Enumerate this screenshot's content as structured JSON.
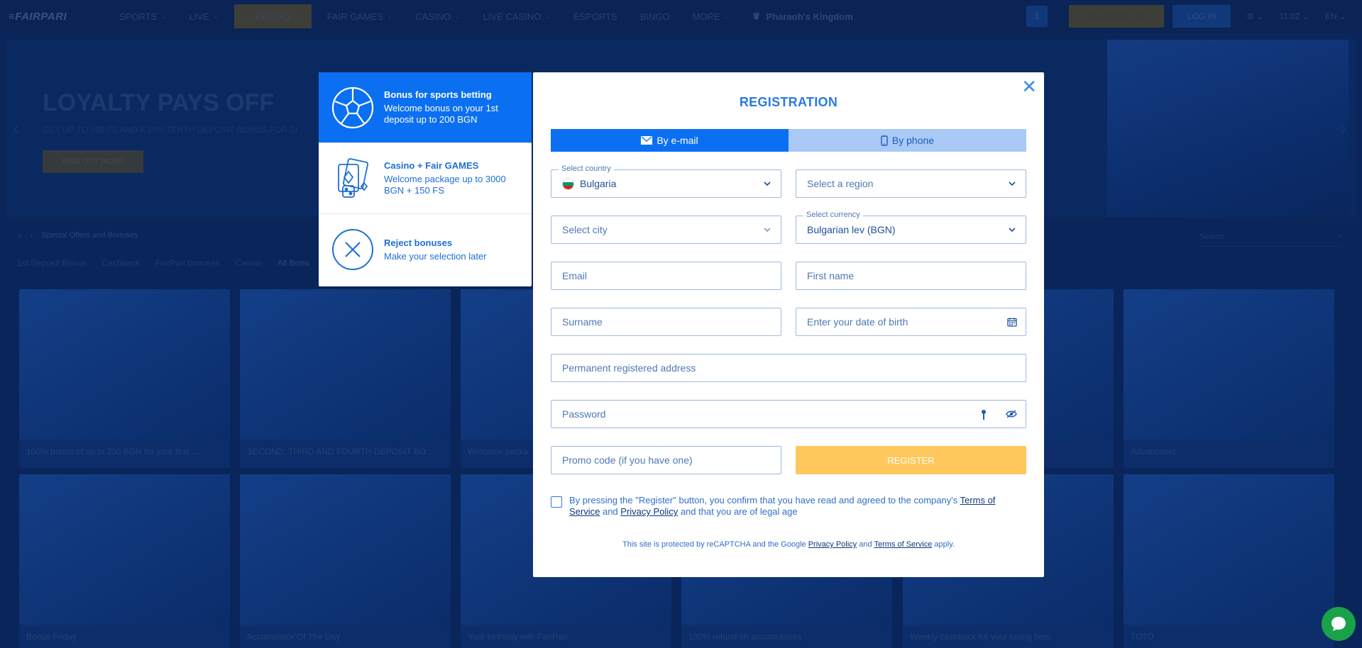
{
  "header": {
    "logo": "≡FAIRPARI",
    "nav": [
      {
        "label": "SPORTS",
        "chevron": true
      },
      {
        "label": "LIVE",
        "chevron": true
      },
      {
        "label": "PROMO",
        "chevron": true,
        "active": true
      },
      {
        "label": "FAIR GAMES",
        "chevron": true
      },
      {
        "label": "CASINO",
        "chevron": true
      },
      {
        "label": "LIVE CASINO",
        "chevron": true
      },
      {
        "label": "ESPORTS",
        "chevron": false
      },
      {
        "label": "BINGO",
        "chevron": false
      },
      {
        "label": "MORE",
        "chevron": true
      }
    ],
    "special": "Pharaoh's Kingdom",
    "notif_count": "1",
    "register_label": "REGISTRATION",
    "login_label": "LOG IN",
    "time": "11:02",
    "lang": "EN"
  },
  "hero": {
    "title": "LOYALTY PAYS OFF",
    "subtitle": "GET UP TO 100 FS AND A 50% TENTH DEPOSIT BONUS FOR SI",
    "button": "FIND OUT MORE"
  },
  "breadcrumbs": {
    "current": "Special Offers and Bonuses"
  },
  "tabs": [
    "1st Deposit Bonus",
    "Cashback",
    "FairPari bonuses",
    "Casino",
    "All Bonu"
  ],
  "search_placeholder": "Search",
  "cards_row1": [
    "100% bonus of up to 200 BGN for your first ...",
    "SECOND, THIRD AND FOURTH DEPOSIT BO...",
    "Welcome packa",
    "",
    "",
    "Advancebet"
  ],
  "cards_row2": [
    "Bonus Friday",
    "Accumulator Of The Day",
    "Your birthday with FairPari",
    "100% refund on accumulators",
    "Weekly cashback for your losing bets",
    "TOTO"
  ],
  "bonus_options": [
    {
      "title": "Bonus for sports betting",
      "desc": "Welcome bonus on your 1st deposit up to 200 BGN",
      "icon": "soccer-ball-icon",
      "selected": true
    },
    {
      "title": "Casino + Fair GAMES",
      "desc": "Welcome package up to 3000 BGN + 150 FS",
      "icon": "casino-cards-icon",
      "selected": false
    },
    {
      "title": "Reject bonuses",
      "desc": "Make your selection later",
      "icon": "reject-x-icon",
      "selected": false
    }
  ],
  "modal": {
    "title": "REGISTRATION",
    "tab_email": "By e-mail",
    "tab_phone": "By phone",
    "country_label": "Select country",
    "country_value": "Bulgaria",
    "region_placeholder": "Select a region",
    "city_placeholder": "Select city",
    "currency_label": "Select currency",
    "currency_value": "Bulgarian lev (BGN)",
    "email_placeholder": "Email",
    "firstname_placeholder": "First name",
    "surname_placeholder": "Surname",
    "dob_placeholder": "Enter your date of birth",
    "address_placeholder": "Permanent registered address",
    "password_placeholder": "Password",
    "promo_placeholder": "Promo code (if you have one)",
    "register_button": "REGISTER",
    "agree_pre": "By pressing the \"Register\" button, you confirm that you have read and agreed to the company's ",
    "agree_tos": "Terms of Service",
    "agree_and": " and ",
    "agree_privacy": "Privacy Policy",
    "agree_post": " and that you are of legal age",
    "captcha_pre": "This site is protected by reCAPTCHA and the Google ",
    "captcha_privacy": "Privacy Policy",
    "captcha_and": " and ",
    "captcha_tos": "Terms of Service",
    "captcha_post": " apply."
  },
  "colors": {
    "primary": "#0b6ff2",
    "register_button": "#ffc85c",
    "tab_inactive": "#a9c9f7",
    "background": "#0a2d6a",
    "chat": "#19a24a"
  }
}
